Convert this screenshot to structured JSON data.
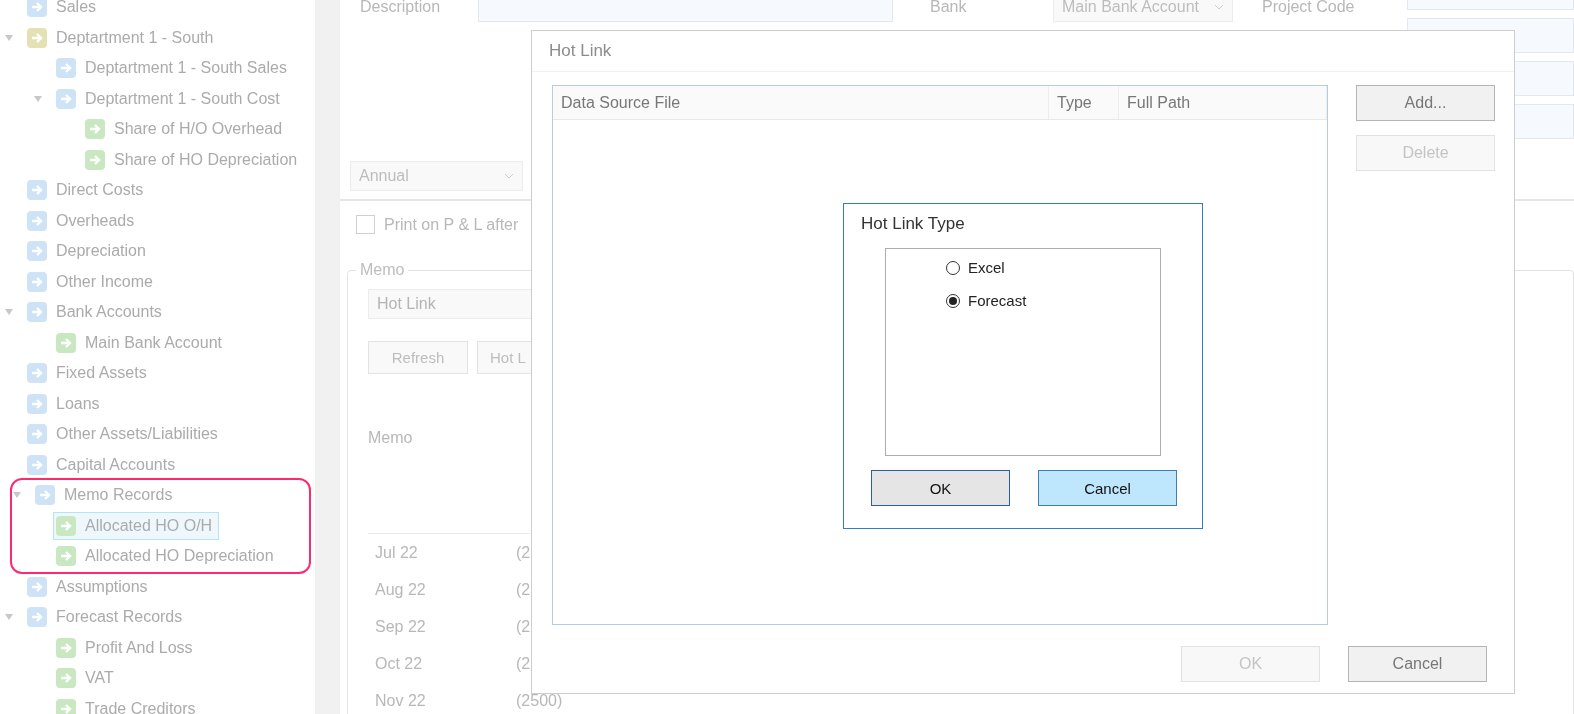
{
  "sidebar": {
    "tree": [
      {
        "label": "Sales",
        "color": "#cfe3f6",
        "selected": false,
        "highlighted": false
      },
      {
        "label": "Deptartment 1 - South",
        "color": "#e4e2b4",
        "expanded": true,
        "selected": false,
        "highlighted": false,
        "children": [
          {
            "label": "Deptartment 1 - South Sales",
            "color": "#cfe3f6",
            "selected": false
          },
          {
            "label": "Deptartment 1 - South Cost",
            "color": "#cfe3f6",
            "expanded": true,
            "selected": false,
            "children": [
              {
                "label": "Share of H/O Overhead",
                "color": "#c9e8c2",
                "selected": false
              },
              {
                "label": "Share of  HO Depreciation",
                "color": "#c9e8c2",
                "selected": false
              }
            ]
          }
        ]
      },
      {
        "label": "Direct Costs",
        "color": "#cfe3f6",
        "selected": false,
        "highlighted": false
      },
      {
        "label": "Overheads",
        "color": "#cfe3f6",
        "selected": false,
        "highlighted": false
      },
      {
        "label": "Depreciation",
        "color": "#cfe3f6",
        "selected": false,
        "highlighted": false
      },
      {
        "label": "Other Income",
        "color": "#cfe3f6",
        "selected": false,
        "highlighted": false
      },
      {
        "label": "Bank Accounts",
        "color": "#cfe3f6",
        "expanded": true,
        "selected": false,
        "highlighted": false,
        "children": [
          {
            "label": "Main Bank Account",
            "color": "#c9e8c2",
            "selected": false
          }
        ]
      },
      {
        "label": "Fixed Assets",
        "color": "#cfe3f6",
        "selected": false,
        "highlighted": false
      },
      {
        "label": "Loans",
        "color": "#cfe3f6",
        "selected": false,
        "highlighted": false
      },
      {
        "label": "Other Assets/Liabilities",
        "color": "#cfe3f6",
        "selected": false,
        "highlighted": false
      },
      {
        "label": "Capital Accounts",
        "color": "#cfe3f6",
        "selected": false,
        "highlighted": false
      },
      {
        "label": "Memo Records",
        "color": "#cfe3f6",
        "expanded": true,
        "selected": false,
        "highlighted": true,
        "children": [
          {
            "label": "Allocated HO  O/H",
            "color": "#c9e8c2",
            "selected": true
          },
          {
            "label": "Allocated HO Depreciation",
            "color": "#c9e8c2",
            "selected": false
          }
        ]
      },
      {
        "label": "Assumptions",
        "color": "#cfe3f6",
        "selected": false,
        "highlighted": false
      },
      {
        "label": "Forecast Records",
        "color": "#cfe3f6",
        "expanded": true,
        "selected": false,
        "highlighted": false,
        "children": [
          {
            "label": "Profit And Loss",
            "color": "#c9e8c2",
            "selected": false
          },
          {
            "label": "VAT",
            "color": "#c9e8c2",
            "selected": false
          },
          {
            "label": "Trade Creditors",
            "color": "#c9e8c2",
            "selected": false
          }
        ]
      }
    ]
  },
  "form": {
    "description_label": "Description",
    "bank_label": "Bank",
    "bank_value": "Main Bank Account",
    "project_code_label": "Project Code",
    "period": "Annual",
    "print_checkbox": {
      "label": "Print on P & L after",
      "checked": false
    },
    "memo_group": {
      "legend": "Memo",
      "source_field": "Hot Link",
      "buttons": [
        "Refresh",
        "Hot L"
      ],
      "memo_label": "Memo",
      "months": [
        {
          "label": "Jul 22",
          "value": "(2"
        },
        {
          "label": "Aug 22",
          "value": "(2"
        },
        {
          "label": "Sep 22",
          "value": "(2"
        },
        {
          "label": "Oct 22",
          "value": "(2"
        },
        {
          "label": "Nov 22",
          "value": "(2500)"
        }
      ]
    }
  },
  "hot_link_dialog": {
    "title": "Hot Link",
    "columns": [
      "Data Source File",
      "Type",
      "Full Path"
    ],
    "side_buttons": [
      {
        "label": "Add...",
        "disabled": false
      },
      {
        "label": "Delete",
        "disabled": true
      }
    ],
    "footer_buttons": [
      {
        "label": "OK",
        "disabled": true
      },
      {
        "label": "Cancel",
        "disabled": false
      }
    ]
  },
  "hot_link_type_dialog": {
    "title": "Hot Link Type",
    "options": [
      {
        "label": "Excel",
        "selected": false
      },
      {
        "label": "Forecast",
        "selected": true
      }
    ],
    "buttons": [
      {
        "label": "OK",
        "highlighted": false
      },
      {
        "label": "Cancel",
        "highlighted": true
      }
    ]
  }
}
